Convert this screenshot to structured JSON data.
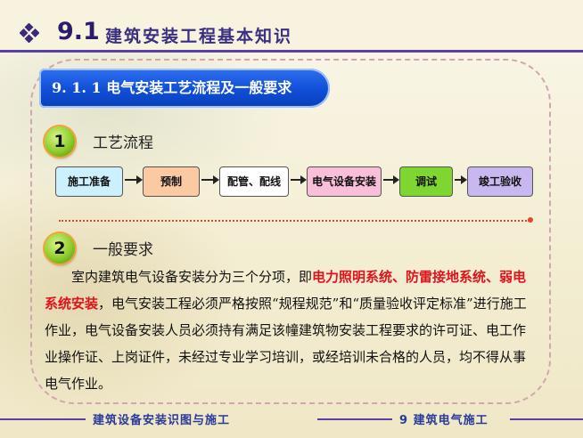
{
  "header": {
    "section_number": "9.1",
    "title": "建筑安装工程基本知识"
  },
  "banner": {
    "title": "9. 1. 1   电气安装工艺流程及一般要求"
  },
  "section1": {
    "number": "1",
    "label": "工艺流程"
  },
  "process_steps": [
    {
      "label": "施工准备",
      "color": "#ccf0ff"
    },
    {
      "label": "预制",
      "color": "#fbcaa3"
    },
    {
      "label": "配管、配线",
      "color": "#ffffff"
    },
    {
      "label": "电气设备安装",
      "color": "#f9bfd8"
    },
    {
      "label": "调试",
      "color": "#7fd630"
    },
    {
      "label": "竣工验收",
      "color": "#c9b8f0"
    }
  ],
  "section2": {
    "number": "2",
    "label": "一般要求"
  },
  "body": {
    "p1_part1": "室内建筑电气设备安装分为三个分项，即",
    "p1_red": "电力照明系统、防雷接地系统、弱电系统安装",
    "p1_part2": "，电气安装工程必须严格按照“规程规范”和“质量验收评定标准”进行施工作业，电气设备安装人员必须持有满足该幢建筑物安装工程要求的许可证、电工作业操作证、上岗证件，未经过专业学习培训，或经培训未合格的人员，均不得从事电气作业。"
  },
  "footer": {
    "left": "建筑设备安装识图与施工",
    "right": "9 建筑电气施工"
  },
  "colors": {
    "accent": "#5b3fa6",
    "banner": "#0f4fd8",
    "highlight_red": "#e0131a"
  }
}
